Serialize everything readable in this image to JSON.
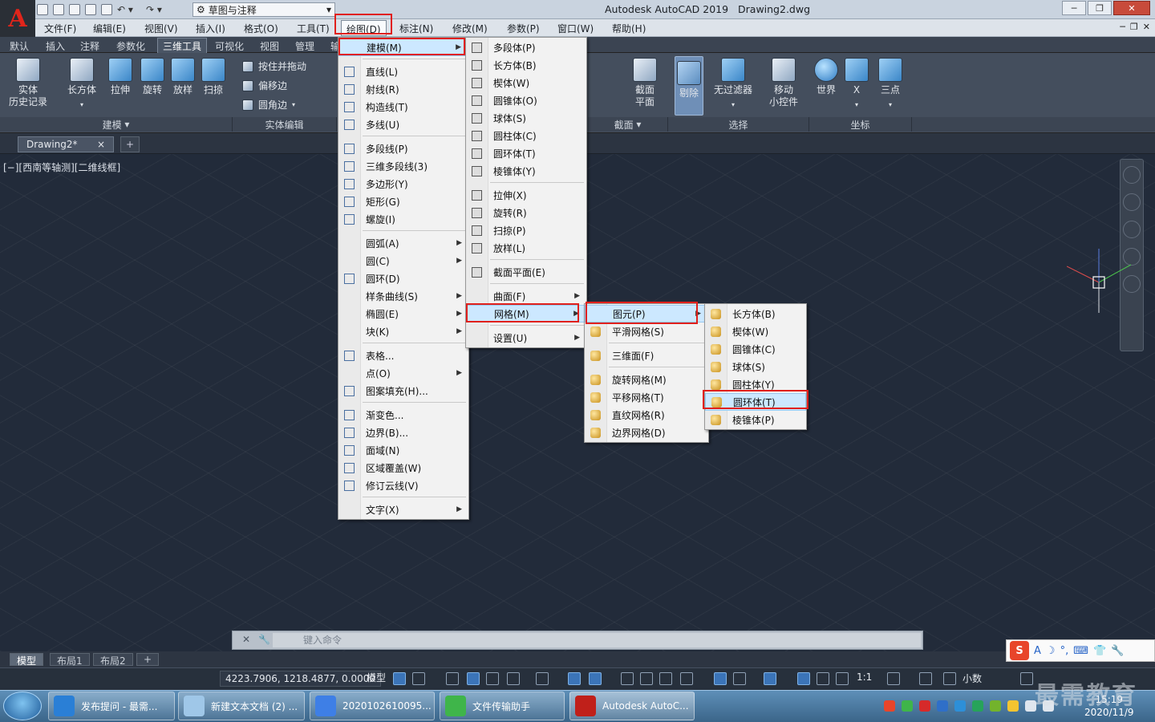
{
  "app": {
    "title": "Autodesk AutoCAD 2019",
    "document": "Drawing2.dwg",
    "logo": "A",
    "workspace": "草图与注释"
  },
  "window_controls": {
    "minimize": "─",
    "restore": "❐",
    "close": "✕"
  },
  "menubar": [
    "文件(F)",
    "编辑(E)",
    "视图(V)",
    "插入(I)",
    "格式(O)",
    "工具(T)",
    "绘图(D)",
    "标注(N)",
    "修改(M)",
    "参数(P)",
    "窗口(W)",
    "帮助(H)"
  ],
  "ribbon_tabs": [
    "默认",
    "插入",
    "注释",
    "参数化",
    "三维工具",
    "可视化",
    "视图",
    "管理",
    "输"
  ],
  "ribbon": {
    "history": "实体\n历史记录",
    "box": "长方体",
    "extrude": "拉伸",
    "revolve": "旋转",
    "loft": "放样",
    "sweep": "扫掠",
    "presspull": "按住并拖动",
    "offset_edge": "偏移边",
    "fillet_edge": "圆角边",
    "section_plane": "截面\n平面",
    "remove": "剔除",
    "no_filter": "无过滤器",
    "gizmo": "移动\n小控件",
    "world": "世界",
    "x": "X",
    "three_point": "三点",
    "panels": {
      "modeling": "建模",
      "solid_edit": "实体编辑",
      "section": "截面",
      "selection": "选择",
      "coordinates": "坐标"
    }
  },
  "doc_tab": {
    "name": "Drawing2*",
    "close": "×",
    "add": "+"
  },
  "viewport_label": "[−][西南等轴测][二维线框]",
  "draw_menu": {
    "items": [
      {
        "label": "建模(M)",
        "submenu": true,
        "icon": ""
      },
      {
        "label": "直线(L)",
        "icon": "line-icon"
      },
      {
        "label": "射线(R)",
        "icon": "ray-icon"
      },
      {
        "label": "构造线(T)",
        "icon": "xline-icon"
      },
      {
        "label": "多线(U)",
        "icon": "multiline-icon"
      },
      {
        "label": "多段线(P)",
        "icon": "polyline-icon"
      },
      {
        "label": "三维多段线(3)",
        "icon": "3dpolyline-icon"
      },
      {
        "label": "多边形(Y)",
        "icon": "polygon-icon"
      },
      {
        "label": "矩形(G)",
        "icon": "rectangle-icon"
      },
      {
        "label": "螺旋(I)",
        "icon": "helix-icon"
      },
      {
        "label": "圆弧(A)",
        "submenu": true,
        "icon": ""
      },
      {
        "label": "圆(C)",
        "submenu": true,
        "icon": ""
      },
      {
        "label": "圆环(D)",
        "icon": "donut-icon"
      },
      {
        "label": "样条曲线(S)",
        "submenu": true,
        "icon": ""
      },
      {
        "label": "椭圆(E)",
        "submenu": true,
        "icon": ""
      },
      {
        "label": "块(K)",
        "submenu": true,
        "icon": ""
      },
      {
        "label": "表格...",
        "icon": "table-icon"
      },
      {
        "label": "点(O)",
        "submenu": true,
        "icon": ""
      },
      {
        "label": "图案填充(H)...",
        "icon": "hatch-icon"
      },
      {
        "label": "渐变色...",
        "icon": "gradient-icon"
      },
      {
        "label": "边界(B)...",
        "icon": "boundary-icon"
      },
      {
        "label": "面域(N)",
        "icon": "region-icon"
      },
      {
        "label": "区域覆盖(W)",
        "icon": "wipeout-icon"
      },
      {
        "label": "修订云线(V)",
        "icon": "revcloud-icon"
      },
      {
        "label": "文字(X)",
        "submenu": true,
        "icon": ""
      }
    ]
  },
  "modeling_menu": {
    "items": [
      {
        "label": "多段体(P)",
        "icon": "polysolid-icon"
      },
      {
        "label": "长方体(B)",
        "icon": "box-icon"
      },
      {
        "label": "楔体(W)",
        "icon": "wedge-icon"
      },
      {
        "label": "圆锥体(O)",
        "icon": "cone-icon"
      },
      {
        "label": "球体(S)",
        "icon": "sphere-icon"
      },
      {
        "label": "圆柱体(C)",
        "icon": "cylinder-icon"
      },
      {
        "label": "圆环体(T)",
        "icon": "torus-icon"
      },
      {
        "label": "棱锥体(Y)",
        "icon": "pyramid-icon"
      },
      {
        "label": "拉伸(X)",
        "icon": "extrude-icon"
      },
      {
        "label": "旋转(R)",
        "icon": "revolve-icon"
      },
      {
        "label": "扫掠(P)",
        "icon": "sweep-icon"
      },
      {
        "label": "放样(L)",
        "icon": "loft-icon"
      },
      {
        "label": "截面平面(E)",
        "icon": "section-plane-icon"
      },
      {
        "label": "曲面(F)",
        "submenu": true
      },
      {
        "label": "网格(M)",
        "submenu": true
      },
      {
        "label": "设置(U)",
        "submenu": true
      }
    ]
  },
  "mesh_menu": {
    "items": [
      {
        "label": "图元(P)",
        "submenu": true
      },
      {
        "label": "平滑网格(S)",
        "icon": "smooth-mesh-icon"
      },
      {
        "label": "三维面(F)",
        "icon": "3dface-icon"
      },
      {
        "label": "旋转网格(M)",
        "icon": "revsurf-icon"
      },
      {
        "label": "平移网格(T)",
        "icon": "tabsurf-icon"
      },
      {
        "label": "直纹网格(R)",
        "icon": "rulesurf-icon"
      },
      {
        "label": "边界网格(D)",
        "icon": "edgesurf-icon"
      }
    ]
  },
  "primitives_menu": {
    "items": [
      {
        "label": "长方体(B)",
        "icon": "mesh-box-icon"
      },
      {
        "label": "楔体(W)",
        "icon": "mesh-wedge-icon"
      },
      {
        "label": "圆锥体(C)",
        "icon": "mesh-cone-icon"
      },
      {
        "label": "球体(S)",
        "icon": "mesh-sphere-icon"
      },
      {
        "label": "圆柱体(Y)",
        "icon": "mesh-cylinder-icon"
      },
      {
        "label": "圆环体(T)",
        "icon": "mesh-torus-icon"
      },
      {
        "label": "棱锥体(P)",
        "icon": "mesh-pyramid-icon"
      }
    ]
  },
  "command_line": {
    "placeholder": "键入命令"
  },
  "layout_tabs": [
    "模型",
    "布局1",
    "布局2"
  ],
  "status": {
    "coords": "4223.7906, 1218.4877, 0.0000",
    "model": "模型",
    "scale": "1:1",
    "units": "小数"
  },
  "taskbar": {
    "items": [
      "发布提问 - 最需...",
      "新建文本文档 (2) ...",
      "2020102610095...",
      "文件传输助手",
      "Autodesk AutoC..."
    ],
    "time": "15:19",
    "date": "2020/11/9"
  },
  "watermark": "最需教育",
  "colors": {
    "highlight_red": "#e0201c",
    "canvas": "#222b3a",
    "menu_hover": "#cce8ff"
  }
}
